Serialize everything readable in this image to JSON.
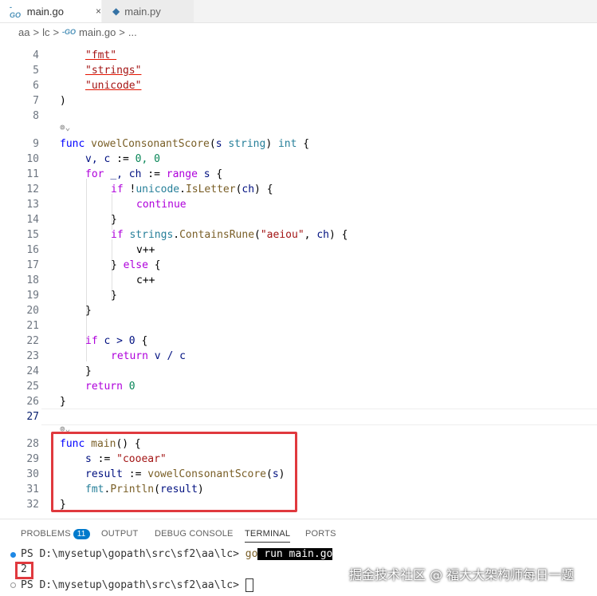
{
  "tabs": [
    {
      "label": "main.go",
      "close": "×"
    },
    {
      "label": "main.py"
    }
  ],
  "breadcrumb": {
    "items": [
      "aa",
      ">",
      "lc",
      ">",
      "main.go",
      ">",
      "..."
    ]
  },
  "editor": {
    "lines": [
      {
        "n": "4"
      },
      {
        "n": "5"
      },
      {
        "n": "6"
      },
      {
        "n": "7"
      },
      {
        "n": "8"
      },
      {
        "n": "9"
      },
      {
        "n": "10"
      },
      {
        "n": "11"
      },
      {
        "n": "12"
      },
      {
        "n": "13"
      },
      {
        "n": "14"
      },
      {
        "n": "15"
      },
      {
        "n": "16"
      },
      {
        "n": "17"
      },
      {
        "n": "18"
      },
      {
        "n": "19"
      },
      {
        "n": "20"
      },
      {
        "n": "21"
      },
      {
        "n": "22"
      },
      {
        "n": "23"
      },
      {
        "n": "24"
      },
      {
        "n": "25"
      },
      {
        "n": "26"
      },
      {
        "n": "27"
      },
      {
        "n": "28"
      },
      {
        "n": "29"
      },
      {
        "n": "30"
      },
      {
        "n": "31"
      },
      {
        "n": "32"
      }
    ],
    "code": {
      "l4": "\"fmt\"",
      "l5": "\"strings\"",
      "l6": "\"unicode\"",
      "l7": ")",
      "l9_func": "func",
      "l9_name": "vowelConsonantScore",
      "l9_param": "s",
      "l9_type": "string",
      "l9_ret": "int",
      "l10_vars": "v, c",
      "l10_assign": ":=",
      "l10_vals": "0, 0",
      "l11_for": "for",
      "l11_vars": "_, ch",
      "l11_range": "range",
      "l12_if": "if",
      "l12_pkg": "unicode",
      "l12_fn": "IsLetter",
      "l13_continue": "continue",
      "l15_if": "if",
      "l15_pkg": "strings",
      "l15_fn": "ContainsRune",
      "l15_str": "\"aeiou\"",
      "l16": "v++",
      "l17_else": "else",
      "l18": "c++",
      "l22_if": "if",
      "l22_cond": "c > 0",
      "l23_return": "return",
      "l23_expr": "v / c",
      "l25_return": "return",
      "l25_val": "0",
      "l28_func": "func",
      "l28_name": "main",
      "l29_var": "s",
      "l29_str": "\"cooear\"",
      "l30_var": "result",
      "l30_fn": "vowelConsonantScore",
      "l31_pkg": "fmt",
      "l31_fn": "Println",
      "l31_arg": "result"
    }
  },
  "panel": {
    "tabs": [
      "PROBLEMS",
      "OUTPUT",
      "DEBUG CONSOLE",
      "TERMINAL",
      "PORTS"
    ],
    "problems_count": "11",
    "terminal": {
      "prompt1": "PS D:\\mysetup\\gopath\\src\\sf2\\aa\\lc>",
      "cmd_go": "go",
      "cmd_rest": " run main.go",
      "output": "2",
      "prompt2": "PS D:\\mysetup\\gopath\\src\\sf2\\aa\\lc>"
    }
  },
  "watermark": "掘金技术社区 @ 福大大架构师每日一题",
  "colors": {
    "accent": "#007acc",
    "highlight": "#e0393e"
  }
}
